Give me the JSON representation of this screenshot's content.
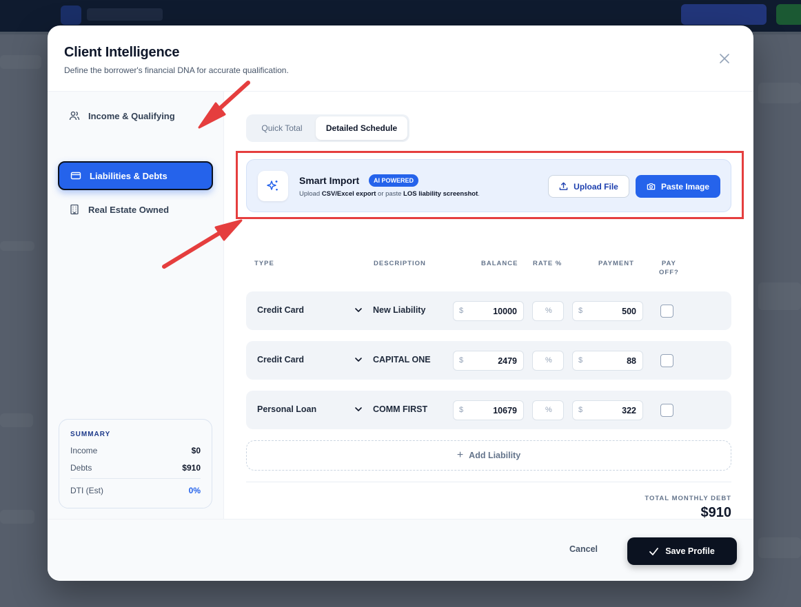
{
  "modal": {
    "title": "Client Intelligence",
    "subtitle": "Define the borrower's financial DNA for accurate qualification."
  },
  "sidebar": {
    "items": [
      {
        "label": "Income & Qualifying",
        "icon": "users-icon",
        "active": false
      },
      {
        "label": "Liabilities & Debts",
        "icon": "credit-card-icon",
        "active": true
      },
      {
        "label": "Real Estate Owned",
        "icon": "building-icon",
        "active": false
      }
    ]
  },
  "summary": {
    "title": "SUMMARY",
    "income_label": "Income",
    "income_value": "$0",
    "debts_label": "Debts",
    "debts_value": "$910",
    "dti_label": "DTI (Est)",
    "dti_value": "0%"
  },
  "tabs": {
    "quick_total": "Quick Total",
    "detailed_schedule": "Detailed Schedule",
    "active": "Detailed Schedule"
  },
  "smart_import": {
    "title": "Smart Import",
    "badge": "AI POWERED",
    "desc_prefix": "Upload ",
    "desc_strong1": "CSV/Excel export",
    "desc_middle": " or paste ",
    "desc_strong2": "LOS liability screenshot",
    "desc_suffix": ".",
    "upload_label": "Upload File",
    "paste_label": "Paste Image"
  },
  "table": {
    "headers": {
      "type": "TYPE",
      "description": "DESCRIPTION",
      "balance": "BALANCE",
      "rate": "RATE %",
      "payment": "PAYMENT",
      "payoff_line1": "PAY",
      "payoff_line2": "OFF?"
    },
    "currency_symbol": "$",
    "rate_placeholder": "%",
    "rows": [
      {
        "type": "Credit Card",
        "description": "New Liability",
        "balance": "10000",
        "payment": "500",
        "payoff": false
      },
      {
        "type": "Credit Card",
        "description": "CAPITAL ONE",
        "balance": "2479",
        "payment": "88",
        "payoff": false
      },
      {
        "type": "Personal Loan",
        "description": "COMM FIRST",
        "balance": "10679",
        "payment": "322",
        "payoff": false
      }
    ]
  },
  "add_liability_label": "Add Liability",
  "total": {
    "label": "TOTAL MONTHLY DEBT",
    "value": "$910"
  },
  "footer": {
    "cancel_label": "Cancel",
    "save_label": "Save Profile"
  },
  "colors": {
    "accent": "#2563eb",
    "dark": "#0b1220",
    "annotation": "#e53e3e"
  }
}
